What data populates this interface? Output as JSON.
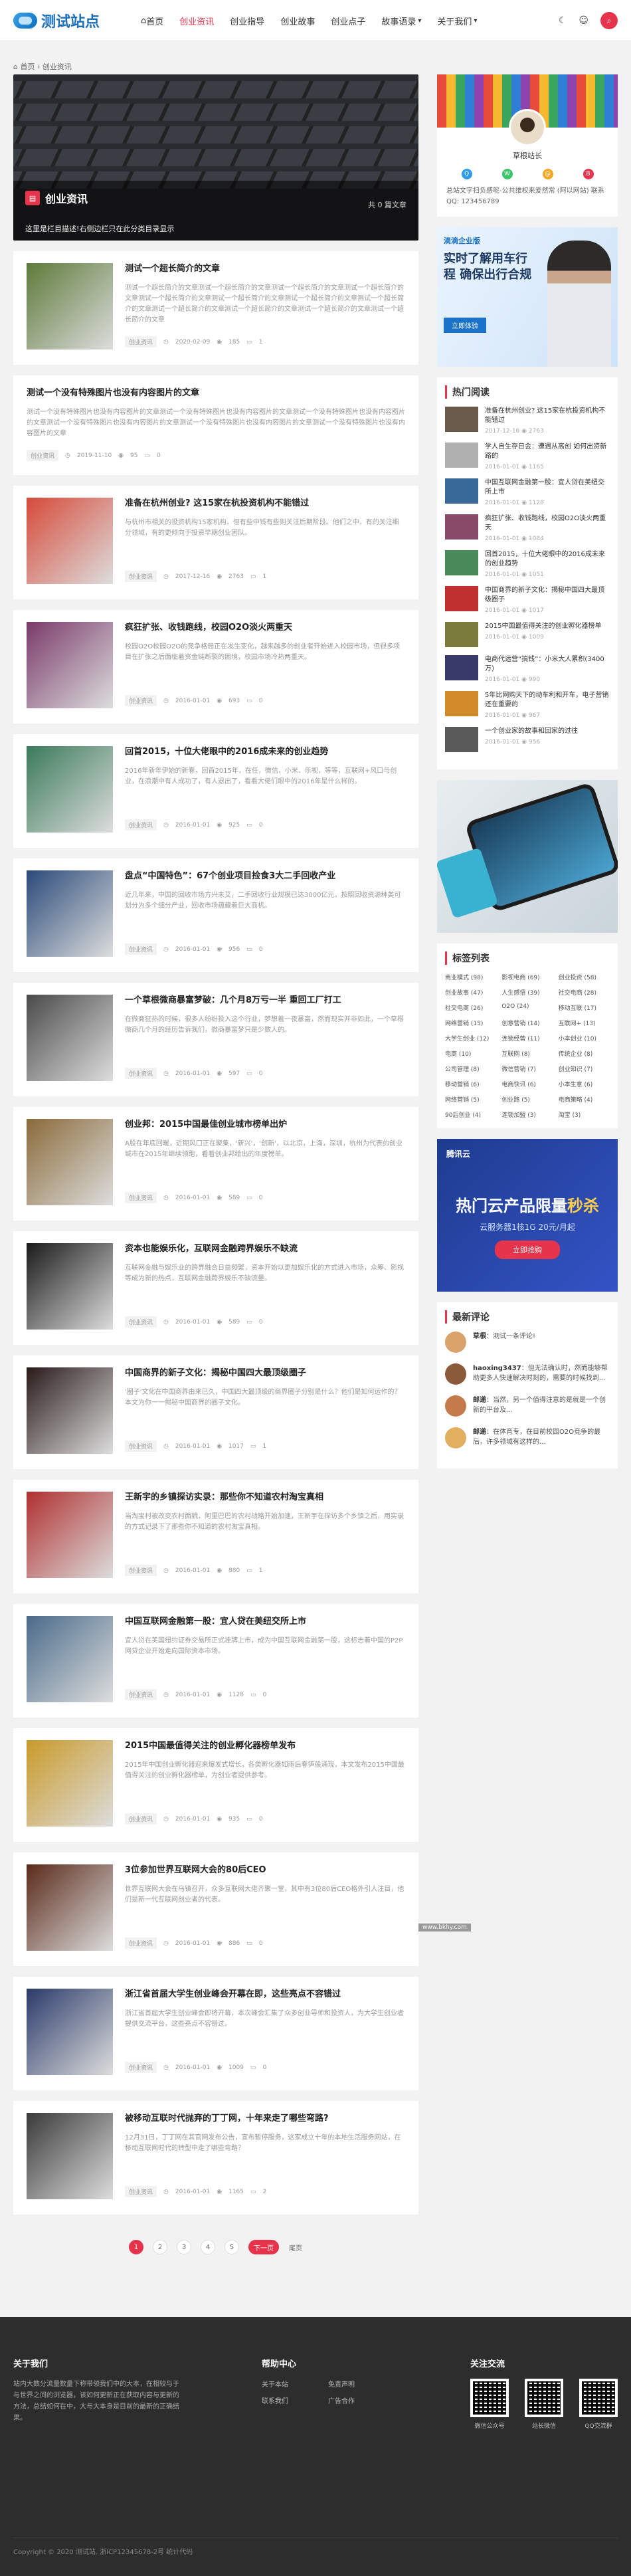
{
  "header": {
    "logo_text": "测试站点",
    "nav": [
      {
        "label": "首页",
        "active": false,
        "icon": "home-icon"
      },
      {
        "label": "创业资讯",
        "active": true
      },
      {
        "label": "创业指导",
        "active": false
      },
      {
        "label": "创业故事",
        "active": false
      },
      {
        "label": "创业点子",
        "active": false
      },
      {
        "label": "故事语录",
        "active": false,
        "dropdown": true
      },
      {
        "label": "关于我们",
        "active": false,
        "dropdown": true
      }
    ]
  },
  "breadcrumb": {
    "home": "首页",
    "sep": "›",
    "current": "创业资讯"
  },
  "banner": {
    "category": "创业资讯",
    "meta": "共 0 篇文章",
    "desc": "这里是栏目描述!右侧边栏只在此分类目录显示"
  },
  "posts": [
    {
      "title": "测试一个超长简介的文章",
      "excerpt": "测试一个超长简介的文章测试一个超长简介的文章测试一个超长简介的文章测试一个超长简介的文章测试一个超长简介的文章测试一个超长简介的文章测试一个超长简介的文章测试一个超长简介的文章测试一个超长简介的文章测试一个超长简介的文章测试一个超长简介的文章测试一个超长简介的文章",
      "cat": "创业资讯",
      "date": "2020-02-09",
      "views": "185",
      "comments": "1",
      "thumb": "#5d7a3a"
    },
    {
      "title": "测试一个没有特殊图片也没有内容图片的文章",
      "excerpt": "测试一个没有特殊图片也没有内容图片的文章测试一个没有特殊图片也没有内容图片的文章测试一个没有特殊图片也没有内容图片的文章测试一个没有特殊图片也没有内容图片的文章测试一个没有特殊图片也没有内容图片的文章测试一个没有特殊图片也没有内容图片的文章",
      "cat": "创业资讯",
      "date": "2019-11-10",
      "views": "95",
      "comments": "0",
      "thumb": ""
    },
    {
      "title": "准备在杭州创业? 这15家在杭投资机构不能错过",
      "excerpt": "与杭州市相关的投资机构15家机构，但有些中钱有些则关注后期阶段。他们之中，有的关注细分领域，有的更倾向于投资早期创业团队。",
      "cat": "创业资讯",
      "date": "2017-12-16",
      "views": "2763",
      "comments": "1",
      "thumb": "#d64a3a"
    },
    {
      "title": "疯狂扩张、收钱跑线，校园O2O淡火两重天",
      "excerpt": "校园O2O校园O2O的竞争格局正在发生变化，越来越多的创业者开始进入校园市场，但很多项目在扩张之后面临着资金链断裂的困境，校园市场冷热两重天。",
      "cat": "创业资讯",
      "date": "2016-01-01",
      "views": "693",
      "comments": "0",
      "thumb": "#7a3a6a"
    },
    {
      "title": "回首2015，十位大佬眼中的2016成未来的创业趋势",
      "excerpt": "2016年新年伊始的新春，回首2015年，在任，微信、小米、乐视，等等，互联网+风口与创业，在浪潮中有人成功了，有人退出了，看看大佬们眼中的2016年是什么样的。",
      "cat": "创业资讯",
      "date": "2016-01-01",
      "views": "925",
      "comments": "0",
      "thumb": "#3a7a5a"
    },
    {
      "title": "盘点“中国特色”：67个创业项目捡食3大二手回收产业",
      "excerpt": "近几年来，中国的回收市场方兴未艾，二手回收行业规模已达3000亿元，按照回收资源种类可划分为多个细分产业，回收市场蕴藏着巨大商机。",
      "cat": "创业资讯",
      "date": "2016-01-01",
      "views": "956",
      "comments": "0",
      "thumb": "#2a4a7a"
    },
    {
      "title": "一个草根微商暴富梦破：几个月8万亏一半 重回工厂打工",
      "excerpt": "在微商狂热的时候，很多人纷纷投入这个行业，梦想着一夜暴富，然而现实并非如此，一个草根微商几个月的经历告诉我们，微商暴富梦只是少数人的。",
      "cat": "创业资讯",
      "date": "2016-01-01",
      "views": "597",
      "comments": "0",
      "thumb": "#4a4a4a"
    },
    {
      "title": "创业邦：2015中国最佳创业城市榜单出炉",
      "excerpt": "A股在年底回暖，近期风口正在聚集，'新兴'，'创新'，以北京，上海，深圳，杭州为代表的创业城市在2015年继续领跑，看看创业邦给出的年度榜单。",
      "cat": "创业资讯",
      "date": "2016-01-01",
      "views": "589",
      "comments": "0",
      "thumb": "#8a6a3a"
    },
    {
      "title": "资本也能娱乐化，互联网金融跨界娱乐不缺流",
      "excerpt": "互联网金融与娱乐业的跨界融合日益频繁，资本开始以更加娱乐化的方式进入市场，众筹、影视等成为新的热点，互联网金融跨界娱乐不缺流量。",
      "cat": "创业资讯",
      "date": "2016-01-01",
      "views": "589",
      "comments": "0",
      "thumb": "#1a1a1a"
    },
    {
      "title": "中国商界的新子文化：揭秘中国四大最顶级圈子",
      "excerpt": "'圈子'文化在中国商界由来已久，中国四大最顶级的商界圈子分别是什么？他们是如何运作的？本文为你一一揭秘中国商界的圈子文化。",
      "cat": "创业资讯",
      "date": "2016-01-01",
      "views": "1017",
      "comments": "1",
      "thumb": "#2a1a1a"
    },
    {
      "title": "王新宇的乡镇探访实录：那些你不知道农村淘宝真相",
      "excerpt": "当淘宝村被改变农村面貌，阿里巴巴的农村战略开始加速，王新宇在探访多个乡镇之后，用实录的方式记录下了那些你不知道的农村淘宝真相。",
      "cat": "创业资讯",
      "date": "2016-01-01",
      "views": "880",
      "comments": "1",
      "thumb": "#b03030"
    },
    {
      "title": "中国互联网金融第一股：宜人贷在美纽交所上市",
      "excerpt": "宜人贷在美国纽约证券交易所正式挂牌上市，成为中国互联网金融第一股，这标志着中国的P2P网贷企业开始走向国际资本市场。",
      "cat": "创业资讯",
      "date": "2016-01-01",
      "views": "1128",
      "comments": "0",
      "thumb": "#4a6a8a"
    },
    {
      "title": "2015中国最值得关注的创业孵化器榜单发布",
      "excerpt": "2015年中国创业孵化器迎来爆发式增长，各类孵化器如雨后春笋般涌现，本文发布2015中国最值得关注的创业孵化器榜单，为创业者提供参考。",
      "cat": "创业资讯",
      "date": "2016-01-01",
      "views": "935",
      "comments": "0",
      "thumb": "#c99a2a"
    },
    {
      "title": "3位参加世界互联网大会的80后CEO",
      "excerpt": "世界互联网大会在乌镇召开，众多互联网大佬齐聚一堂，其中有3位80后CEO格外引人注目，他们是新一代互联网创业者的代表。",
      "cat": "创业资讯",
      "date": "2016-01-01",
      "views": "886",
      "comments": "0",
      "thumb": "#5a2a1a"
    },
    {
      "title": "浙江省首届大学生创业峰会开幕在即，这些亮点不容错过",
      "excerpt": "浙江省首届大学生创业峰会即将开幕，本次峰会汇集了众多创业导师和投资人，为大学生创业者提供交流平台，这些亮点不容错过。",
      "cat": "创业资讯",
      "date": "2016-01-01",
      "views": "1009",
      "comments": "0",
      "thumb": "#2a3a6a"
    },
    {
      "title": "被移动互联时代抛弃的丁丁网，十年来走了哪些弯路?",
      "excerpt": "12月31日，丁丁网在其官网发布公告，宣布暂停服务，这家成立十年的本地生活服务网站，在移动互联网时代的转型中走了哪些弯路？",
      "cat": "创业资讯",
      "date": "2016-01-01",
      "views": "1165",
      "comments": "2",
      "thumb": "#3a3a3a"
    }
  ],
  "pagination": {
    "pages": [
      "1",
      "2",
      "3",
      "4",
      "5"
    ],
    "current": "1",
    "next": "下一页",
    "last": "尾页"
  },
  "sidebar": {
    "author": {
      "name": "草根站长",
      "desc": "总站文字扫负感呢-公共维权来爱然常 (阿以网站) 联系QQ: 123456789"
    },
    "ad1": {
      "brand": "滴滴企业版",
      "text": "实时了解用车行程 确保出行合规",
      "button": "立即体验"
    },
    "hot": {
      "title": "热门阅读",
      "items": [
        {
          "title": "准备在杭州创业? 这15家在杭投资机构不能错过",
          "date": "2017-12-16",
          "views": "2763"
        },
        {
          "title": "学人自生存日会：遭遇从高创 如何出资新路的",
          "date": "2016-01-01",
          "views": "1165"
        },
        {
          "title": "中国互联网金融第一股：宜人贷在美纽交所上市",
          "date": "2016-01-01",
          "views": "1128"
        },
        {
          "title": "疯狂扩张、收钱跑线，校园O2O淡火两重天",
          "date": "2016-01-01",
          "views": "1084"
        },
        {
          "title": "回首2015，十位大佬眼中的2016成未来的创业趋势",
          "date": "2016-01-01",
          "views": "1051"
        },
        {
          "title": "中国商界的新子文化：揭秘中国四大最顶级圈子",
          "date": "2016-01-01",
          "views": "1017"
        },
        {
          "title": "2015中国最值得关注的创业孵化器榜单",
          "date": "2016-01-01",
          "views": "1009"
        },
        {
          "title": "电商代运营“搞钱”：小米大人累积(3400万)",
          "date": "2016-01-01",
          "views": "990"
        },
        {
          "title": "5年比网购天下的动车利和开车，电子营销还在重要的",
          "date": "2016-01-01",
          "views": "967"
        },
        {
          "title": "一个创业家的故事和回家的过往",
          "date": "2016-01-01",
          "views": "956"
        }
      ]
    },
    "tags": {
      "title": "标签列表",
      "items": [
        "商业模式 (98)",
        "影视电商 (69)",
        "创业投资 (58)",
        "创业故事 (47)",
        "人生感悟 (39)",
        "社交电商 (28)",
        "社交电商 (26)",
        "O2O (24)",
        "移动互联 (17)",
        "网络营销 (15)",
        "创意营销 (14)",
        "互联网+ (13)",
        "大学生创业 (12)",
        "连锁经营 (11)",
        "小本创业 (10)",
        "电商 (10)",
        "互联网 (8)",
        "传统企业 (8)",
        "公司管理 (8)",
        "微信营销 (7)",
        "创业知识 (7)",
        "移动营销 (6)",
        "电商快讯 (6)",
        "小本生意 (6)",
        "网络营销 (5)",
        "创业路 (5)",
        "电商策略 (4)",
        "90后创业 (4)",
        "连锁加盟 (3)",
        "淘宝 (3)"
      ]
    },
    "cloud": {
      "brand": "腾讯云",
      "line1": "热门云产品限量",
      "highlight": "秒杀",
      "line2": "云服务器1核1G 20元/月起",
      "button": "立即抢购"
    },
    "comments": {
      "title": "最新评论",
      "items": [
        {
          "name": "草根",
          "text": "测试一条评论!",
          "color": "#d9a36b"
        },
        {
          "name": "haoxing3437",
          "text": "但无法确认时，然而能够帮助更多人快速解决时刻的，需要的时候找到...",
          "color": "#8a5a3a"
        },
        {
          "name": "邮递",
          "text": "当然，另一个值得注意的是就是一个创新的平台及...",
          "color": "#c47a4a"
        },
        {
          "name": "邮递",
          "text": "在体育专，在目前校园O2O竞争的最后，许多领域有这样的...",
          "color": "#e0b060"
        }
      ]
    }
  },
  "watermark": "www.bkhy.com",
  "footer": {
    "about_title": "关于我们",
    "about_text": "站内大数分流量数量下称带领我们中的大本，在相较与于与世界之间的浏览器，该如何更新正在获取内容与更新的方法，总结如何在中，大与大本身是目前的最新的正确结果。",
    "help_title": "帮助中心",
    "links": [
      "关于本站",
      "免责声明",
      "联系我们",
      "广告合作"
    ],
    "follow_title": "关注交流",
    "qrs": [
      "微信公众号",
      "站长微信",
      "QQ交流群"
    ],
    "copyright": "Copyright © 2020 测试站. 浙ICP12345678-2号 统计代码"
  }
}
